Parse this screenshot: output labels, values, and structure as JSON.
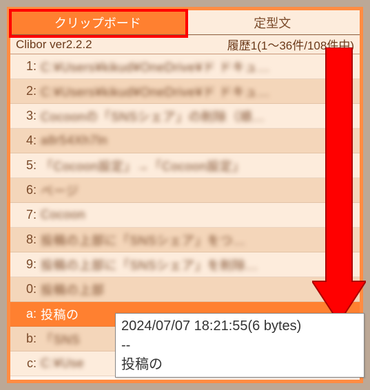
{
  "tabs": {
    "clipboard": "クリップボード",
    "template": "定型文"
  },
  "status": {
    "version": "Clibor ver2.2.2",
    "pager": "履歴1(1～36件/108件中)"
  },
  "rows": [
    {
      "key": "1:",
      "text": "C:¥Users¥kikud¥OneDrive¥ド ドキュ…"
    },
    {
      "key": "2:",
      "text": "C:¥Users¥kikud¥OneDrive¥ド ドキュ…"
    },
    {
      "key": "3:",
      "text": "Cocoonの「SNSシェア」の削除（順…"
    },
    {
      "key": "4:",
      "text": "a8r54Xh7ln"
    },
    {
      "key": "5:",
      "text": "「Cocoon設定」→「Cocoon設定」"
    },
    {
      "key": "6:",
      "text": "ページ"
    },
    {
      "key": "7:",
      "text": "Cocoon"
    },
    {
      "key": "8:",
      "text": "投稿の上部に「SNSシェア」をつ…"
    },
    {
      "key": "9:",
      "text": "投稿の上部に「SNSシェア」を削除…"
    },
    {
      "key": "0:",
      "text": "投稿の上部"
    },
    {
      "key": "a:",
      "text": "投稿の"
    },
    {
      "key": "b:",
      "text": "「SNS"
    },
    {
      "key": "c:",
      "text": "C:¥Use"
    }
  ],
  "tooltip": {
    "timestamp": "2024/07/07 18:21:55(6 bytes)",
    "divider": "--",
    "preview": "投稿の"
  }
}
